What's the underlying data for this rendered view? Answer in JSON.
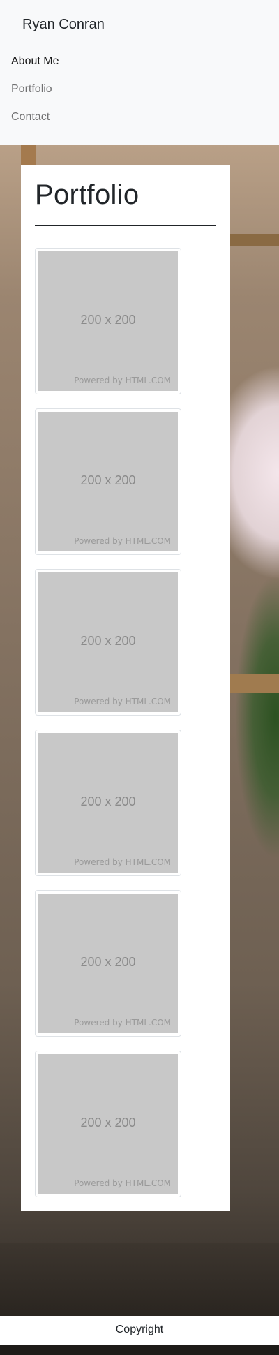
{
  "navbar": {
    "brand": "Ryan Conran",
    "links": [
      {
        "label": "About Me",
        "active": true
      },
      {
        "label": "Portfolio",
        "active": false
      },
      {
        "label": "Contact",
        "active": false
      }
    ]
  },
  "main": {
    "title": "Portfolio",
    "thumbnails": [
      {
        "size_label": "200 x 200",
        "credit": "Powered by HTML.COM"
      },
      {
        "size_label": "200 x 200",
        "credit": "Powered by HTML.COM"
      },
      {
        "size_label": "200 x 200",
        "credit": "Powered by HTML.COM"
      },
      {
        "size_label": "200 x 200",
        "credit": "Powered by HTML.COM"
      },
      {
        "size_label": "200 x 200",
        "credit": "Powered by HTML.COM"
      },
      {
        "size_label": "200 x 200",
        "credit": "Powered by HTML.COM"
      }
    ]
  },
  "footer": {
    "text": "Copyright"
  },
  "colors": {
    "navbar_bg": "#f8f9fa",
    "placeholder_bg": "#c8c8c8",
    "text_dark": "#212529"
  }
}
